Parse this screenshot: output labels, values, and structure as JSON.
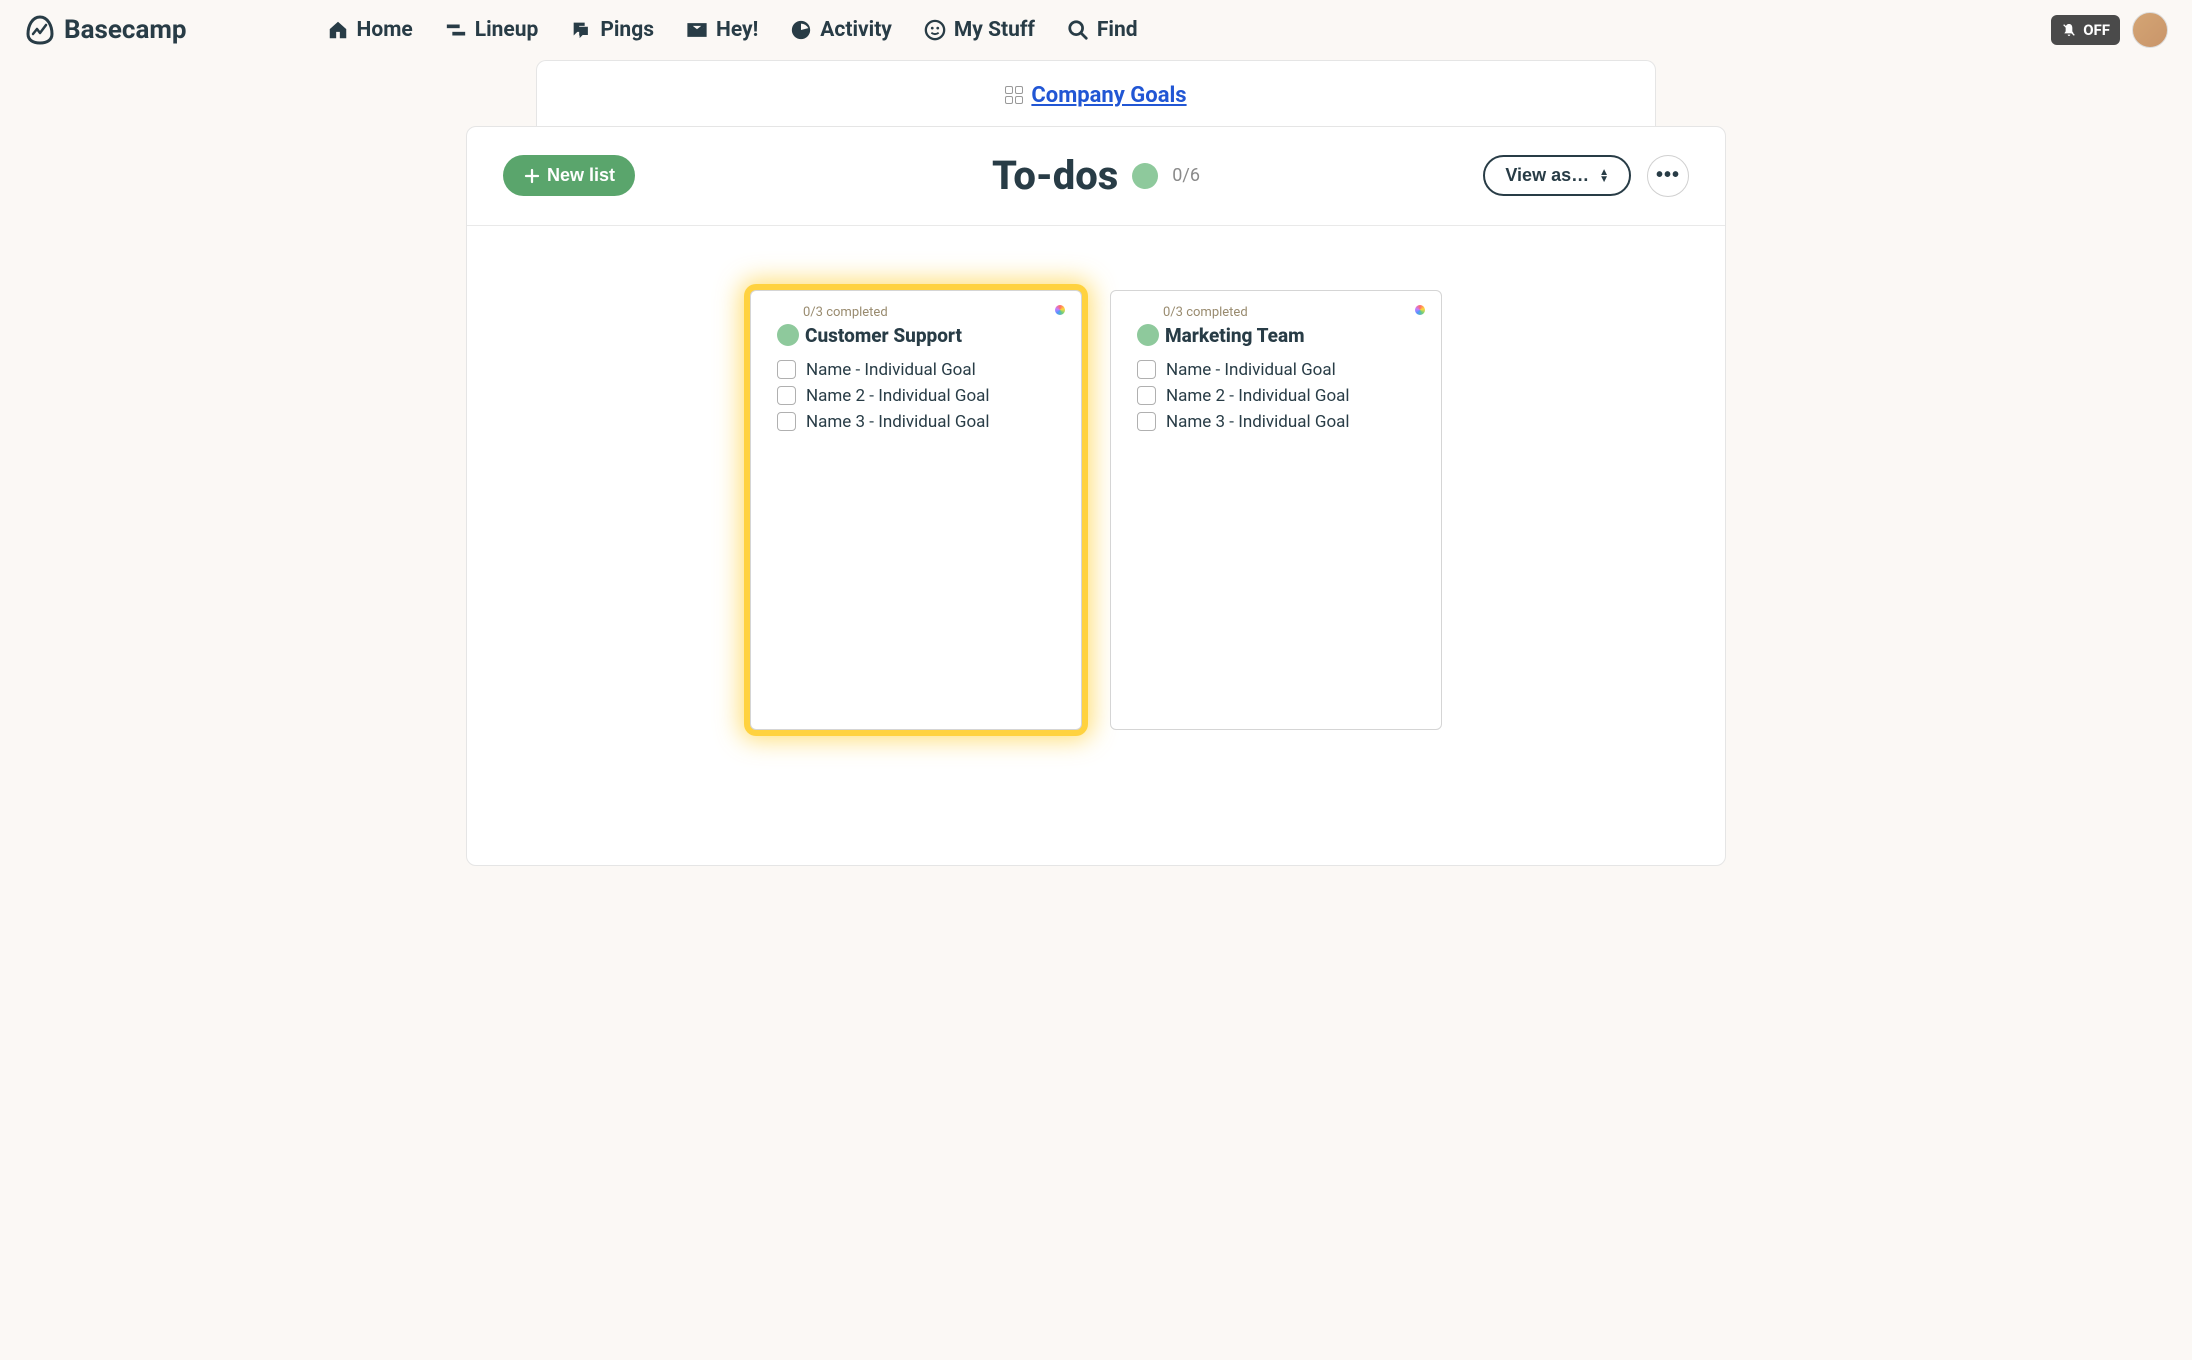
{
  "brand": "Basecamp",
  "nav": {
    "home": "Home",
    "lineup": "Lineup",
    "pings": "Pings",
    "hey": "Hey!",
    "activity": "Activity",
    "mystuff": "My Stuff",
    "find": "Find"
  },
  "notifications_badge": "OFF",
  "breadcrumb": {
    "project": "Company Goals"
  },
  "header": {
    "new_list_label": "New list",
    "title": "To-dos",
    "progress_count": "0/6",
    "view_as_label": "View as…"
  },
  "cards": [
    {
      "completed_text": "0/3 completed",
      "title": "Customer Support",
      "highlighted": true,
      "items": [
        "Name - Individual Goal",
        "Name 2 - Individual Goal",
        "Name 3 - Individual Goal"
      ]
    },
    {
      "completed_text": "0/3 completed",
      "title": "Marketing Team",
      "highlighted": false,
      "items": [
        "Name - Individual Goal",
        "Name 2 - Individual Goal",
        "Name 3 - Individual Goal"
      ]
    }
  ]
}
